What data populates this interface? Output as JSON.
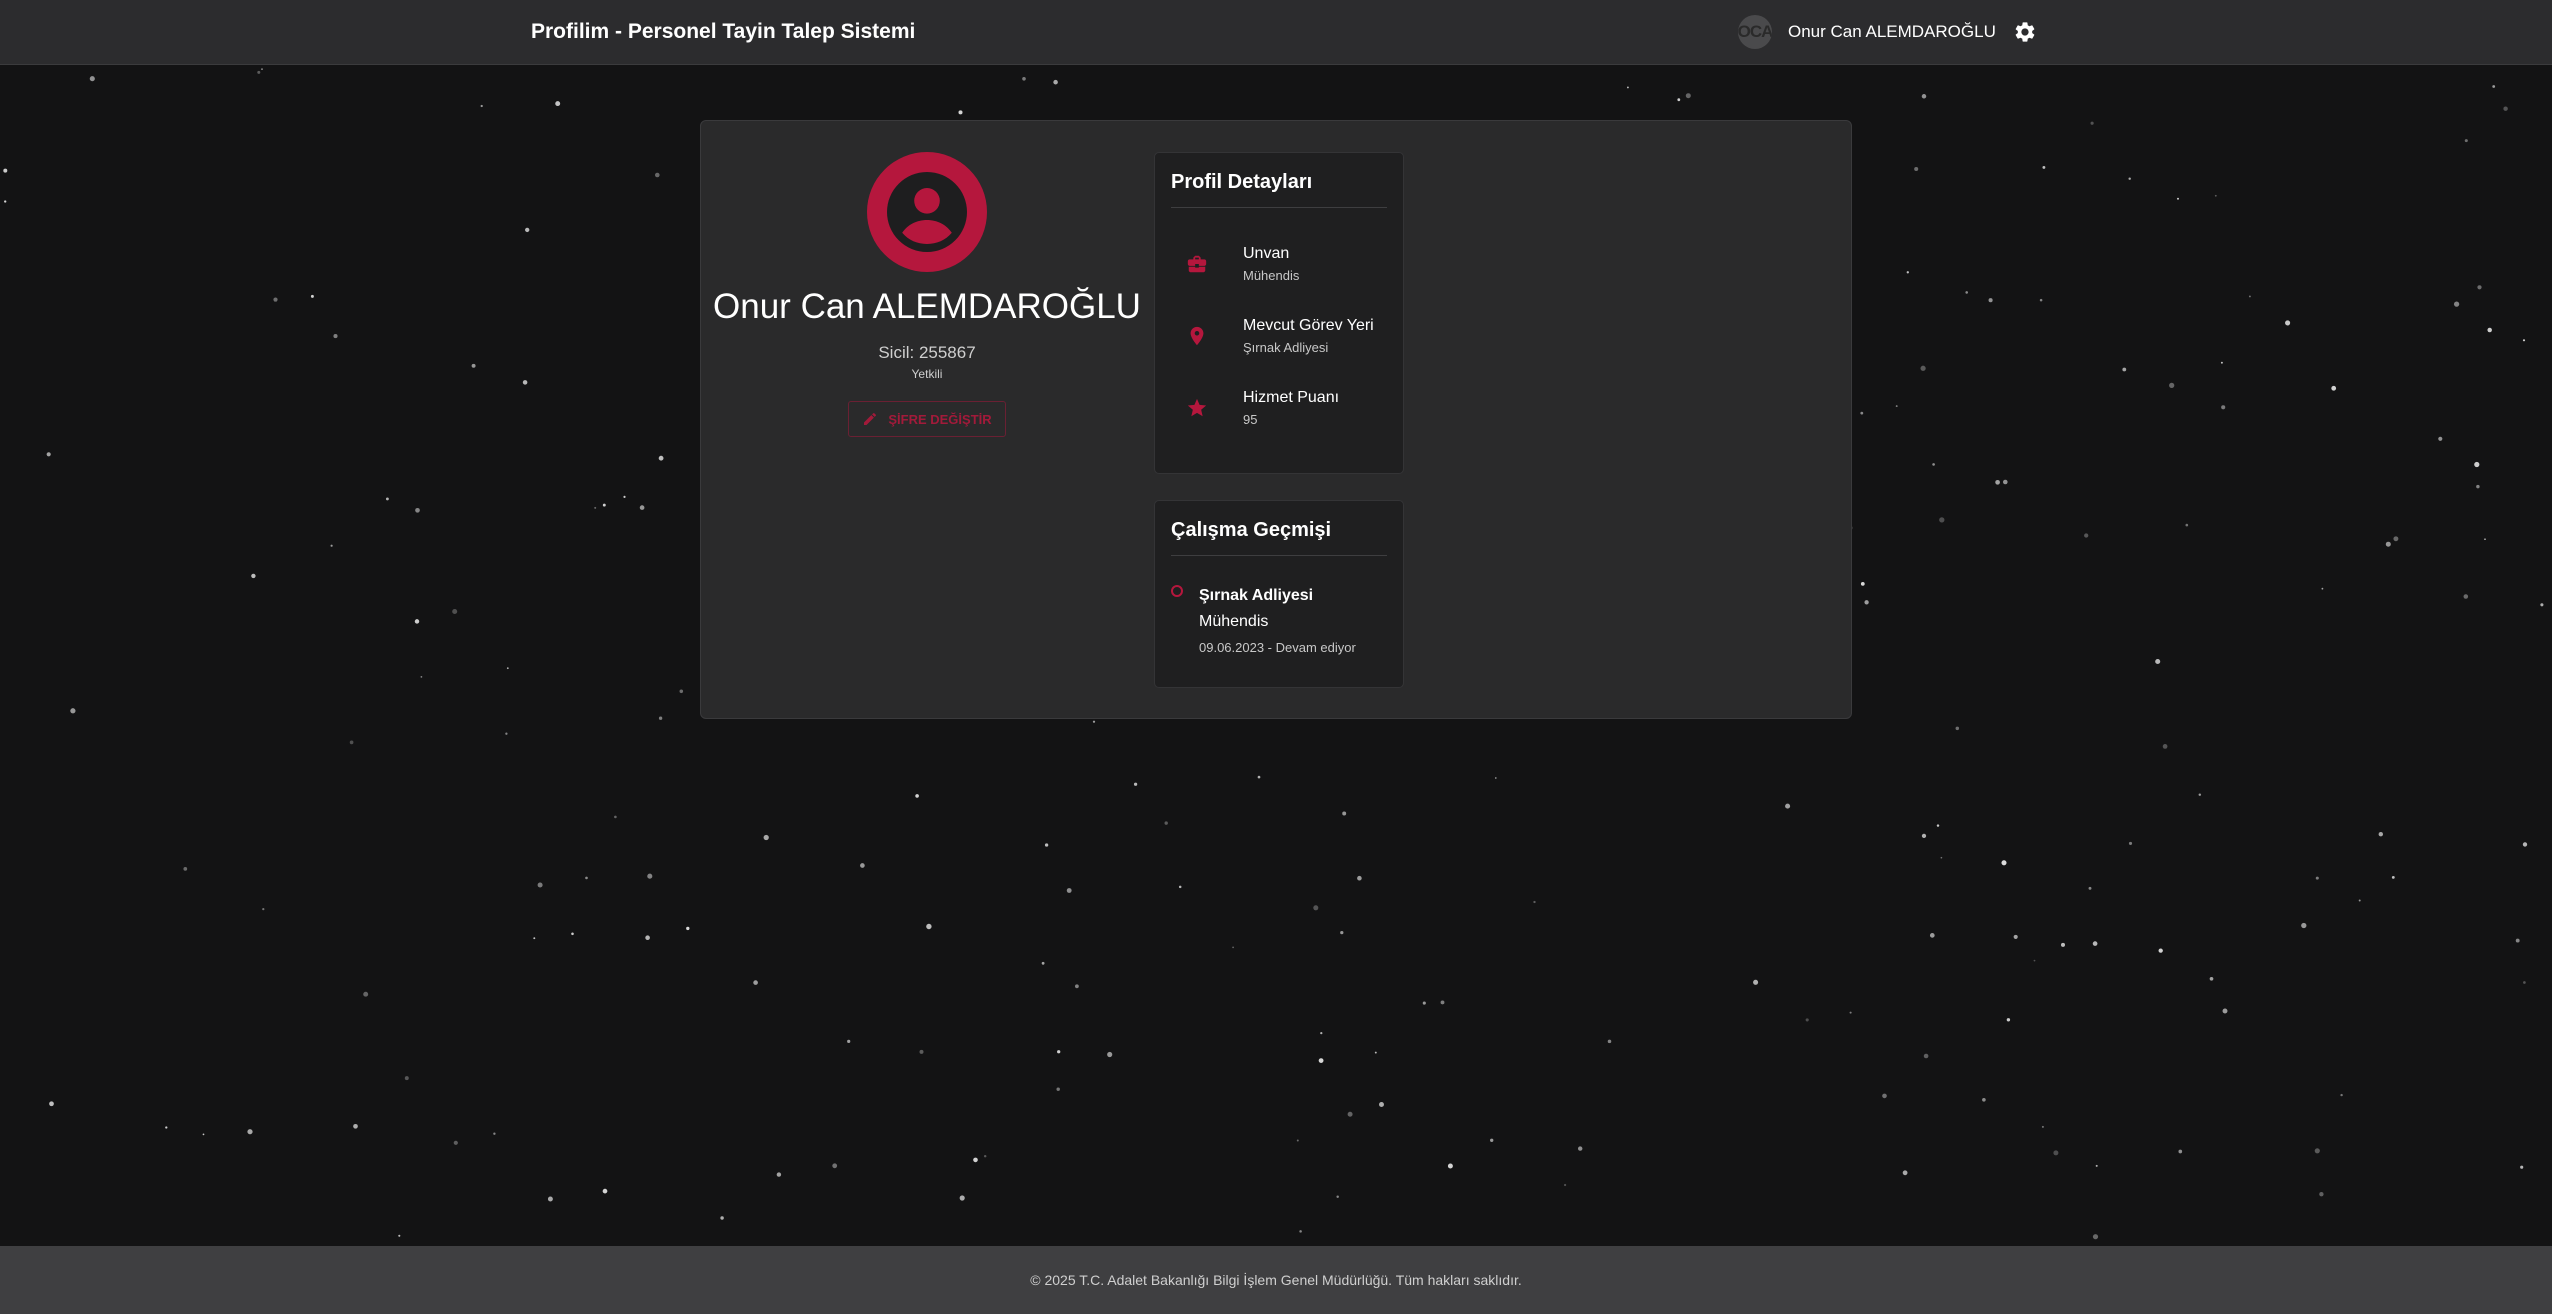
{
  "header": {
    "title": "Profilim - Personel Tayin Talep Sistemi",
    "avatar_initials": "OCA",
    "user_name": "Onur Can ALEMDAROĞLU"
  },
  "profile": {
    "full_name": "Onur Can ALEMDAROĞLU",
    "sicil": "Sicil: 255867",
    "role": "Yetkili",
    "change_password_label": "ŞİFRE DEĞİŞTİR"
  },
  "details": {
    "title": "Profil Detayları",
    "items": [
      {
        "label": "Unvan",
        "value": "Mühendis",
        "icon": "briefcase-icon"
      },
      {
        "label": "Mevcut Görev Yeri",
        "value": "Şırnak Adliyesi",
        "icon": "location-pin-icon"
      },
      {
        "label": "Hizmet Puanı",
        "value": "95",
        "icon": "star-icon"
      }
    ]
  },
  "history": {
    "title": "Çalışma Geçmişi",
    "entries": [
      {
        "place": "Şırnak Adliyesi",
        "role": "Mühendis",
        "dates": "09.06.2023 - Devam ediyor"
      }
    ]
  },
  "footer": {
    "text": "© 2025 T.C. Adalet Bakanlığı Bilgi İşlem Genel Müdürlüğü. Tüm hakları saklıdır."
  },
  "colors": {
    "accent": "#b5173d",
    "background": "#131314",
    "card": "#2a2a2b",
    "header": "#2c2c2e",
    "footer": "#3f3f41"
  }
}
